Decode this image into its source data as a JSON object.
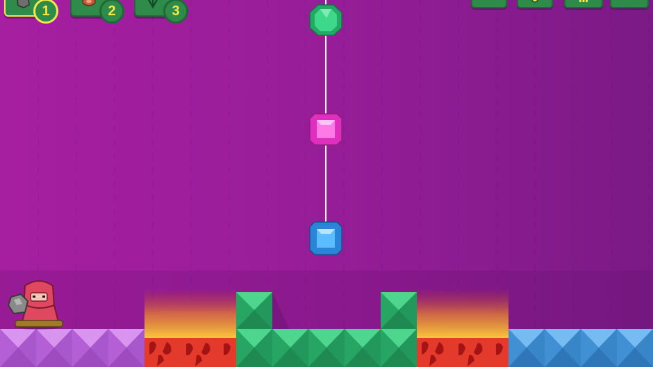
{
  "inventory": {
    "slots": [
      {
        "number": "1",
        "item_icon": "rock-icon",
        "selected": true
      },
      {
        "number": "2",
        "item_icon": "meat-icon",
        "selected": false
      },
      {
        "number": "3",
        "item_icon": "plant-icon",
        "selected": false
      }
    ]
  },
  "menu_buttons": [
    {
      "icon": "menu-button-icon"
    },
    {
      "icon": "coin-icon"
    },
    {
      "icon": "bars-icon"
    },
    {
      "icon": "settings-icon"
    }
  ],
  "gems": [
    {
      "color": "#2ec47a",
      "shape": "octagon",
      "icon": "green-gem-icon"
    },
    {
      "color": "#ff5ad9",
      "shape": "square",
      "icon": "pink-gem-icon"
    },
    {
      "color": "#3aa8ff",
      "shape": "square",
      "icon": "blue-gem-icon"
    }
  ],
  "colors": {
    "background": "#8f1c8f",
    "block_purple": "#c86be8",
    "block_green": "#2ec47a",
    "block_blue": "#4a9fe0",
    "lava": "#e8342b",
    "fire": "#f6b42a",
    "player": "#e84b6a"
  }
}
